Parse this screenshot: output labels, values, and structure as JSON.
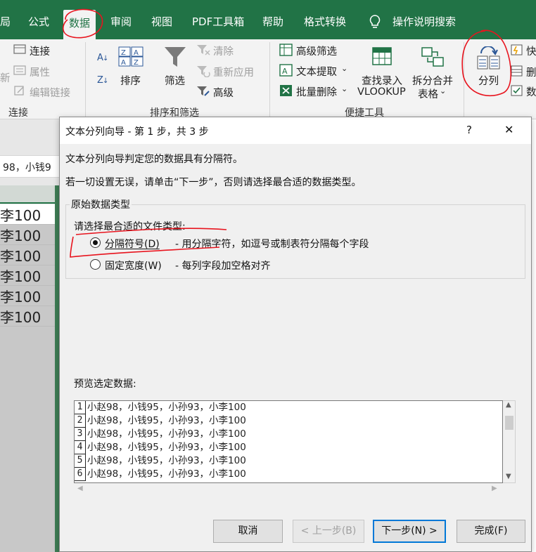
{
  "ribbon_tabs": {
    "layout_partial": "局",
    "formulas": "公式",
    "data": "数据",
    "review": "审阅",
    "view": "视图",
    "pdf_tools": "PDF工具箱",
    "help": "帮助",
    "format_convert": "格式转换",
    "tell_me": "操作说明搜索"
  },
  "ribbon": {
    "connections": {
      "connections": "连接",
      "properties": "属性",
      "edit_links": "编辑链接",
      "new_partial": "新",
      "group_label": "连接"
    },
    "sort_filter": {
      "sort": "排序",
      "filter": "筛选",
      "clear": "清除",
      "reapply": "重新应用",
      "advanced": "高级",
      "group_label": "排序和筛选"
    },
    "quick_tools": {
      "advanced_filter": "高级筛选",
      "text_extract": "文本提取",
      "batch_delete": "批量删除",
      "vlookup_line1": "查找录入",
      "vlookup_line2": "VLOOKUP",
      "split_merge_line1": "拆分合并",
      "split_merge_line2": "表格",
      "group_label": "便捷工具"
    },
    "data_tools": {
      "text_to_columns": "分列",
      "flash_fill_partial": "快",
      "remove_dup_partial": "删",
      "validation_partial": "数"
    }
  },
  "sheet": {
    "formula_fragment": "98，小钱9",
    "cells": [
      "李100",
      "李100",
      "李100",
      "李100",
      "李100",
      "李100"
    ]
  },
  "dialog": {
    "title": "文本分列向导 - 第 1 步，共 3 步",
    "help": "?",
    "close": "✕",
    "intro": "文本分列向导判定您的数据具有分隔符。",
    "instruction": "若一切设置无误，请单击“下一步”，否则请选择最合适的数据类型。",
    "group_title": "原始数据类型",
    "file_type_prompt": "请选择最合适的文件类型:",
    "options": [
      {
        "label": "分隔符号(D)",
        "desc": "- 用分隔字符，如逗号或制表符分隔每个字段",
        "selected": true
      },
      {
        "label": "固定宽度(W)",
        "desc": "- 每列字段加空格对齐",
        "selected": false
      }
    ],
    "preview_label": "预览选定数据:",
    "preview_rows": [
      {
        "num": "1",
        "text": "小赵98，小钱95，小孙93，小李100"
      },
      {
        "num": "2",
        "text": "小赵98，小钱95，小孙93，小李100"
      },
      {
        "num": "3",
        "text": "小赵98，小钱95，小孙93，小李100"
      },
      {
        "num": "4",
        "text": "小赵98，小钱95，小孙93，小李100"
      },
      {
        "num": "5",
        "text": "小赵98，小钱95，小孙93，小李100"
      },
      {
        "num": "6",
        "text": "小赵98，小钱95，小孙93，小李100"
      }
    ],
    "buttons": {
      "cancel": "取消",
      "back": "< 上一步(B)",
      "next": "下一步(N) >",
      "finish": "完成(F)"
    }
  },
  "colors": {
    "excel_green": "#217346",
    "annotation_red": "#e8141e",
    "dialog_bg": "#f0f0f0",
    "focus_blue": "#0078d7"
  }
}
